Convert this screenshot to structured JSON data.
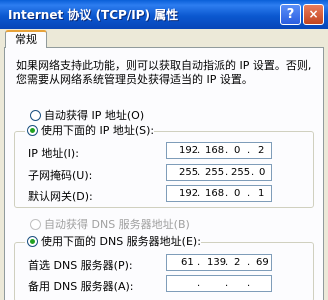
{
  "window": {
    "title": "Internet 协议 (TCP/IP) 属性",
    "help_label": "?",
    "close_label": "×"
  },
  "tabs": {
    "general": "常规"
  },
  "description": {
    "line1": "如果网络支持此功能，则可以获取自动指派的 IP 设置。否则,",
    "line2": "您需要从网络系统管理员处获得适当的 IP 设置。"
  },
  "ip_section": {
    "auto_label": "自动获得 IP 地址(O)",
    "manual_label": "使用下面的 IP 地址(S):",
    "selected": "manual",
    "fields": [
      {
        "label": "IP 地址(I):",
        "octets": [
          "192",
          "168",
          "0",
          "2"
        ]
      },
      {
        "label": "子网掩码(U):",
        "octets": [
          "255",
          "255",
          "255",
          "0"
        ]
      },
      {
        "label": "默认网关(D):",
        "octets": [
          "192",
          "168",
          "0",
          "1"
        ]
      }
    ]
  },
  "dns_section": {
    "auto_label": "自动获得 DNS 服务器地址(B)",
    "auto_disabled": true,
    "manual_label": "使用下面的 DNS 服务器地址(E):",
    "selected": "manual",
    "fields": [
      {
        "label": "首选 DNS 服务器(P):",
        "octets": [
          "61",
          "139",
          "2",
          "69"
        ]
      },
      {
        "label": "备用 DNS 服务器(A):",
        "octets": [
          "",
          "",
          "",
          ""
        ]
      }
    ]
  }
}
